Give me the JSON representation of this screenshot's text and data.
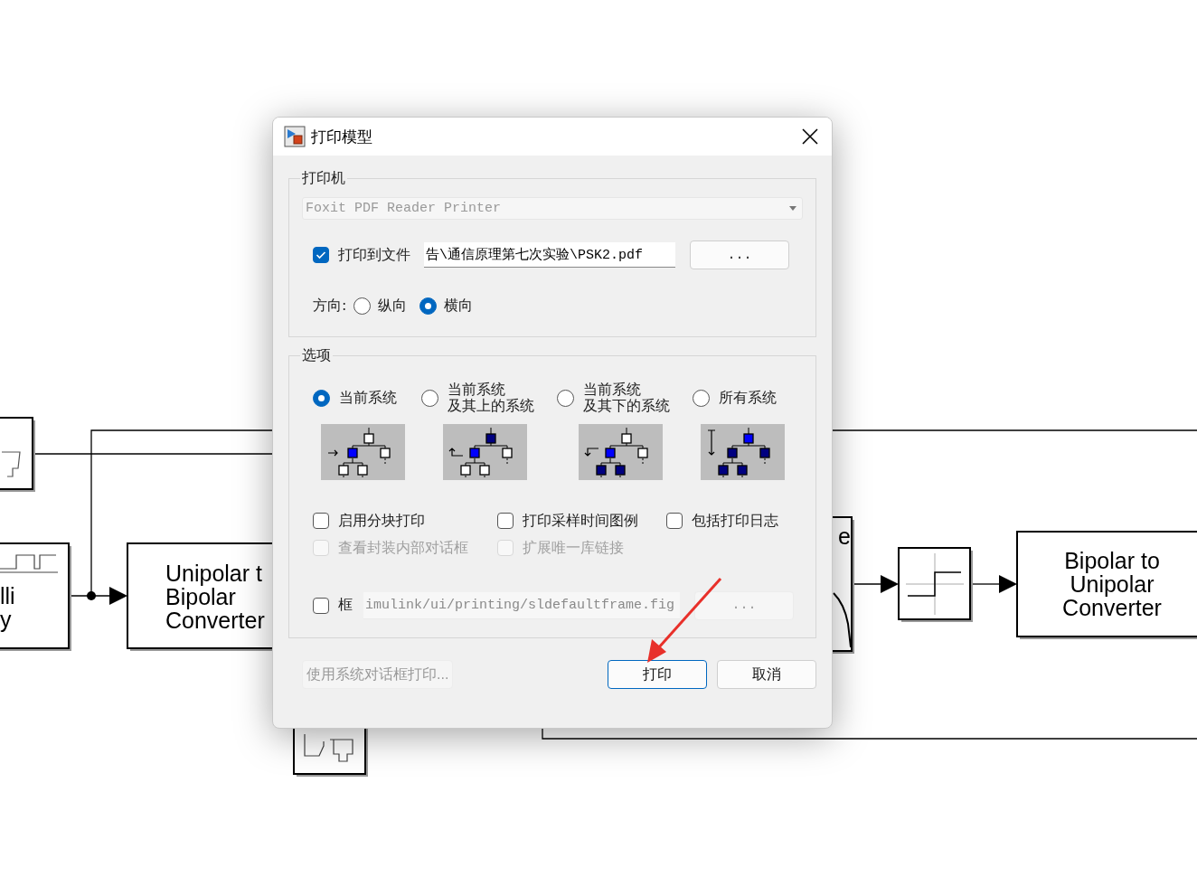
{
  "canvas": {
    "blocks": [
      {
        "lines": [
          "lli",
          "y"
        ]
      },
      {
        "lines": [
          "Unipolar t",
          "Bipolar",
          "Converter"
        ]
      },
      {
        "lines": [
          "e"
        ]
      },
      {
        "lines": [
          "Bipolar to",
          "Unipolar",
          "Converter"
        ]
      }
    ]
  },
  "dialog": {
    "title": "打印模型",
    "printer_group": {
      "legend": "打印机",
      "printer": {
        "value": "Foxit PDF Reader Printer",
        "disabled": true
      },
      "print_to_file": {
        "label": "打印到文件",
        "checked": true,
        "value": "告\\通信原理第七次实验\\PSK2.pdf"
      },
      "browse": "...",
      "orientation_label": "方向:",
      "orientations": [
        {
          "label": "纵向",
          "selected": false
        },
        {
          "label": "横向",
          "selected": true
        }
      ]
    },
    "options_group": {
      "legend": "选项",
      "scopes": [
        {
          "label": "当前系统",
          "selected": true,
          "kind": "current"
        },
        {
          "lines": [
            "当前系统",
            "及其上的系统"
          ],
          "selected": false,
          "kind": "above"
        },
        {
          "lines": [
            "当前系统",
            "及其下的系统"
          ],
          "selected": false,
          "kind": "below"
        },
        {
          "label": "所有系统",
          "selected": false,
          "kind": "all"
        }
      ],
      "checkboxes": [
        {
          "label": "启用分块打印",
          "checked": false,
          "disabled": false
        },
        {
          "label": "打印采样时间图例",
          "checked": false,
          "disabled": false
        },
        {
          "label": "包括打印日志",
          "checked": false,
          "disabled": false
        },
        {
          "label": "查看封装内部对话框",
          "checked": false,
          "disabled": true
        },
        {
          "label": "扩展唯一库链接",
          "checked": false,
          "disabled": true
        }
      ],
      "frame": {
        "label": "框",
        "checked": false,
        "value": "imulink/ui/printing/sldefaultframe.fig",
        "browse": "...",
        "disabled": true
      }
    },
    "system_dialog_button": {
      "label": "使用系统对话框打印...",
      "disabled": true
    },
    "buttons": [
      {
        "label": "打印",
        "kind": "primary"
      },
      {
        "label": "取消",
        "kind": "normal"
      }
    ]
  }
}
